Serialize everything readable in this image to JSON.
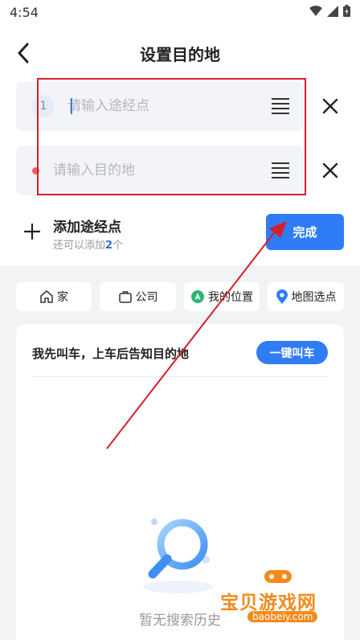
{
  "status_bar": {
    "time": "4:54",
    "icons": [
      "wifi-icon",
      "signal-icon",
      "battery-icon"
    ]
  },
  "nav": {
    "title": "设置目的地",
    "back_icon": "chevron-left-icon"
  },
  "waypoint_input": {
    "index": "1",
    "value": "",
    "placeholder": "请输入途经点"
  },
  "destination_input": {
    "value": "",
    "placeholder": "请输入目的地"
  },
  "add_waypoint": {
    "label": "添加途经点",
    "sub_prefix": "还可以添加",
    "sub_count": "2",
    "sub_suffix": "个"
  },
  "done_button": {
    "label": "完成"
  },
  "quick_chips": [
    {
      "label": "家",
      "icon": "home-icon"
    },
    {
      "label": "公司",
      "icon": "briefcase-icon"
    },
    {
      "label": "我的位置",
      "icon": "location-arrow-icon"
    },
    {
      "label": "地图选点",
      "icon": "map-pin-icon"
    }
  ],
  "card": {
    "title": "我先叫车，上车后告知目的地",
    "call_button": "一键叫车",
    "empty_text": "暂无搜索历史"
  },
  "watermark": {
    "brand": "宝贝游戏网",
    "url": "baobeiy.com"
  },
  "colors": {
    "accent": "#2f7cf6",
    "highlight": "#d61f2c",
    "destination_dot": "#f45b5b",
    "watermark": "#f28a1c"
  }
}
